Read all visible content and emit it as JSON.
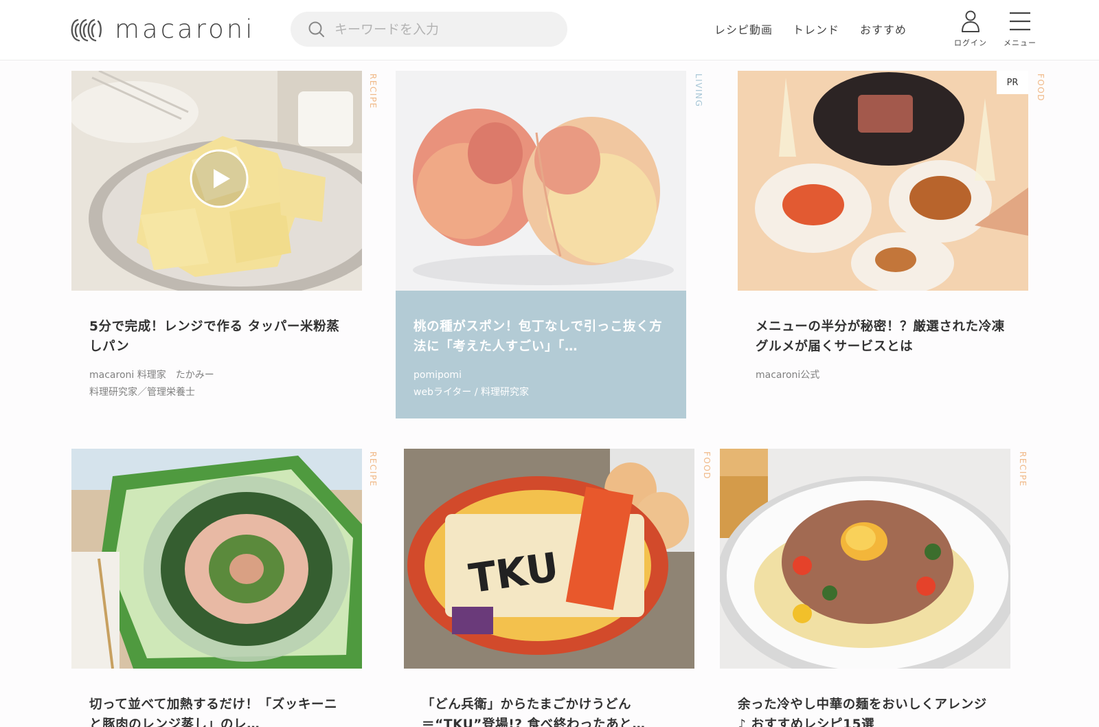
{
  "header": {
    "logo_text": "macaroni",
    "search_placeholder": "キーワードを入力",
    "nav": [
      "レシピ動画",
      "トレンド",
      "おすすめ"
    ],
    "login_label": "ログイン",
    "menu_label": "メニュー"
  },
  "cards": [
    {
      "category": "RECIPE",
      "title": "5分で完成！レンジで作る タッパー米粉蒸しパン",
      "meta_line1": "macaroni 料理家　たかみー",
      "meta_line2": "料理研究家／管理栄養士",
      "has_video": true
    },
    {
      "category": "LIVING",
      "title": "桃の種がスポン！包丁なしで引っこ抜く方法に「考えた人すごい」「…",
      "meta_line1": "pomipomi",
      "meta_line2": "webライター / 料理研究家"
    },
    {
      "category": "FOOD",
      "badge": "PR",
      "title": "メニューの半分が秘密！？厳選された冷凍グルメが届くサービスとは",
      "meta_line1": "macaroni公式"
    },
    {
      "category": "RECIPE",
      "title": "切って並べて加熱するだけ！「ズッキーニと豚肉のレンジ蒸し」のレ…"
    },
    {
      "category": "FOOD",
      "title": "「どん兵衛」からたまごかけうどん＝“TKU”登場!? 食べ終わったあと…"
    },
    {
      "category": "RECIPE",
      "title": "余った冷やし中華の麺をおいしくアレンジ♪ おすすめレシピ15選"
    }
  ]
}
